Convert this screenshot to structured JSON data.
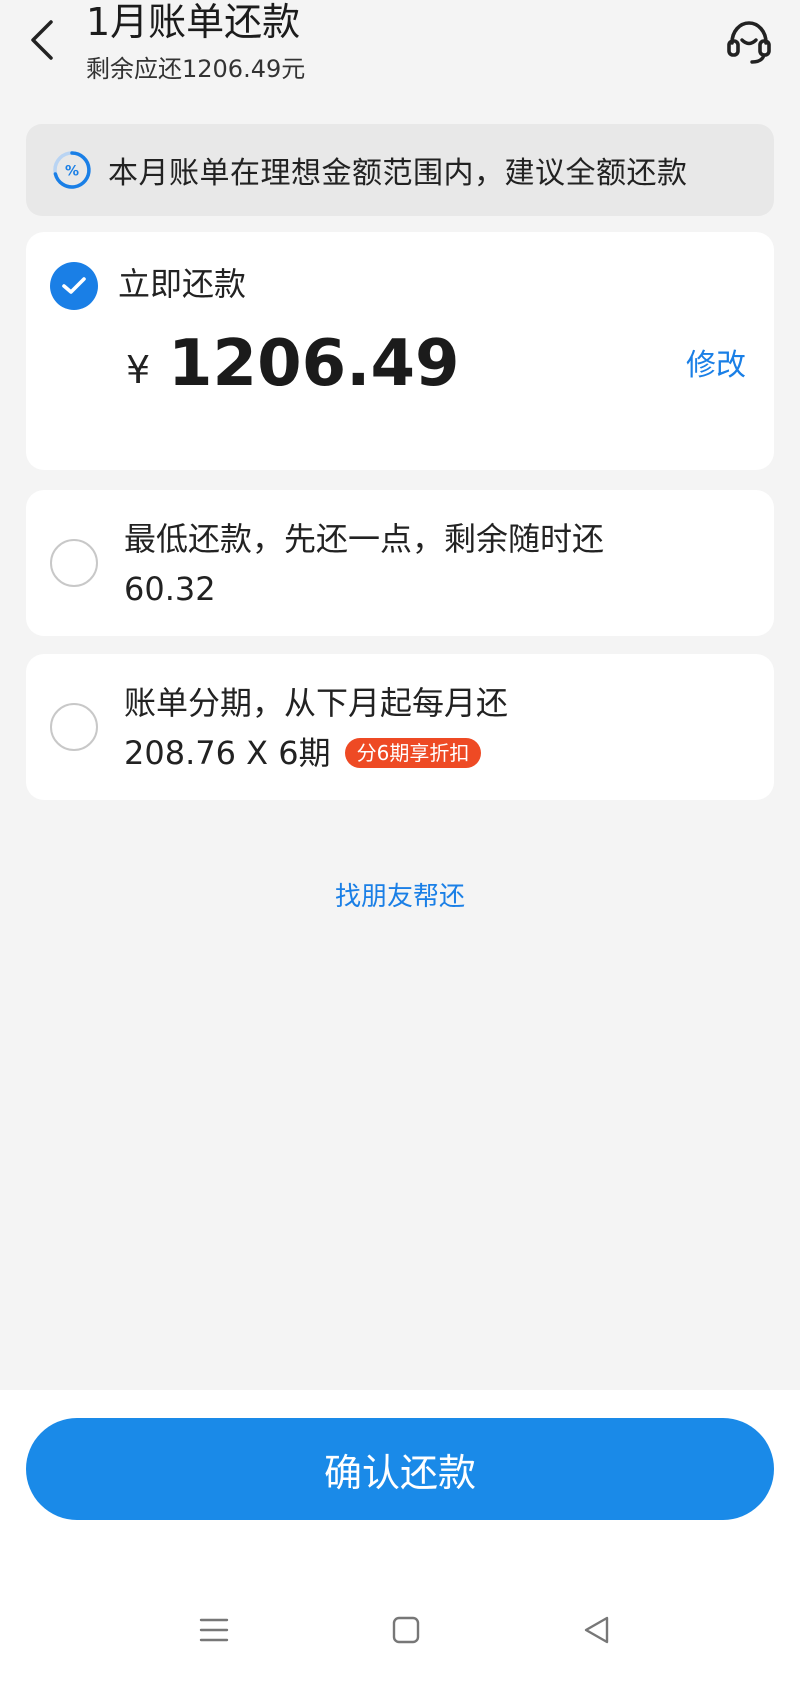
{
  "header": {
    "title": "1月账单还款",
    "subtitle": "剩余应还1206.49元"
  },
  "tip": {
    "text": "本月账单在理想金额范围内，建议全额还款",
    "icon": "percent-progress-icon"
  },
  "options": {
    "full": {
      "label": "立即还款",
      "currency": "¥",
      "amount": "1206.49",
      "edit_label": "修改",
      "selected": true
    },
    "minimum": {
      "label": "最低还款，先还一点，剩余随时还",
      "amount": "60.32",
      "selected": false
    },
    "installment": {
      "label": "账单分期，从下月起每月还",
      "amount": "208.76 X 6期",
      "badge": "分6期享折扣",
      "selected": false
    }
  },
  "friend_link": "找朋友帮还",
  "confirm_label": "确认还款",
  "colors": {
    "accent": "#1a7fe6",
    "button": "#1a8ae8",
    "badge": "#ee4a24",
    "background": "#f4f4f4"
  }
}
